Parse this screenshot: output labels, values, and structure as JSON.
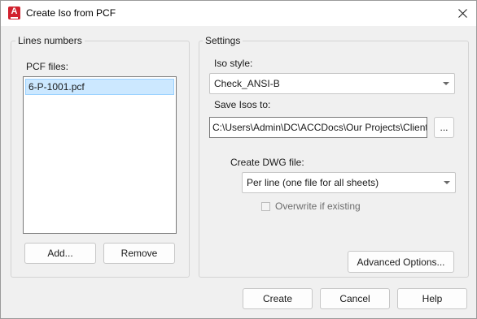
{
  "window": {
    "title": "Create Iso from PCF",
    "icon_letter": "A"
  },
  "lines_group": {
    "legend": "Lines numbers",
    "pcf_label": "PCF files:",
    "pcf_files": [
      "6-P-1001.pcf"
    ],
    "add_label": "Add...",
    "remove_label": "Remove"
  },
  "settings_group": {
    "legend": "Settings",
    "iso_style_label": "Iso style:",
    "iso_style_value": "Check_ANSI-B",
    "save_isos_label": "Save Isos to:",
    "save_isos_value": "C:\\Users\\Admin\\DC\\ACCDocs\\Our Projects\\Client",
    "browse_label": "...",
    "create_dwg_label": "Create DWG file:",
    "create_dwg_value": "Per line (one file for all sheets)",
    "overwrite_label": "Overwrite if existing",
    "overwrite_checked": false,
    "advanced_label": "Advanced Options..."
  },
  "footer": {
    "create_label": "Create",
    "cancel_label": "Cancel",
    "help_label": "Help"
  },
  "colors": {
    "selection_bg": "#cce8ff",
    "selection_border": "#99d1ff",
    "app_icon": "#d1222f"
  }
}
